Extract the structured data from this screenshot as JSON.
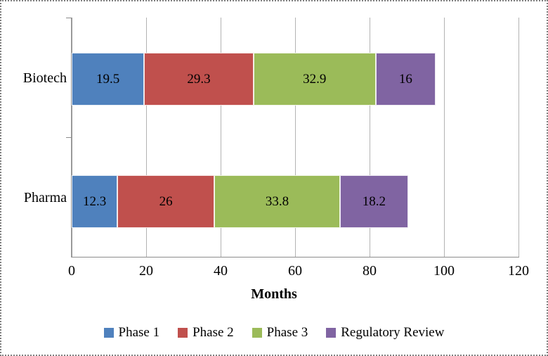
{
  "chart_data": {
    "type": "bar",
    "orientation": "horizontal",
    "stacked": true,
    "title": "",
    "xlabel": "Months",
    "ylabel": "",
    "xlim": [
      0,
      120
    ],
    "xticks": [
      0,
      20,
      40,
      60,
      80,
      100,
      120
    ],
    "grid": true,
    "legend_position": "bottom",
    "categories": [
      "Biotech",
      "Pharma"
    ],
    "series": [
      {
        "name": "Phase 1",
        "color": "#4f81bd",
        "values": [
          19.5,
          12.3
        ]
      },
      {
        "name": "Phase 2",
        "color": "#c0504d",
        "values": [
          29.3,
          26
        ]
      },
      {
        "name": "Phase 3",
        "color": "#9bbb59",
        "values": [
          32.9,
          33.8
        ]
      },
      {
        "name": "Regulatory Review",
        "color": "#8064a2",
        "values": [
          16,
          18.2
        ]
      }
    ],
    "bar_labels": {
      "Biotech": [
        "19.5",
        "29.3",
        "32.9",
        "16"
      ],
      "Pharma": [
        "12.3",
        "26",
        "33.8",
        "18.2"
      ]
    },
    "totals": {
      "Biotech": 97.7,
      "Pharma": 90.3
    }
  },
  "axis": {
    "x_title": "Months",
    "tick_labels": [
      "0",
      "20",
      "40",
      "60",
      "80",
      "100",
      "120"
    ]
  },
  "category_labels": {
    "biotech": "Biotech",
    "pharma": "Pharma"
  },
  "legend": {
    "items": [
      {
        "label": "Phase 1",
        "color": "#4f81bd"
      },
      {
        "label": "Phase 2",
        "color": "#c0504d"
      },
      {
        "label": "Phase 3",
        "color": "#9bbb59"
      },
      {
        "label": "Regulatory Review",
        "color": "#8064a2"
      }
    ]
  }
}
